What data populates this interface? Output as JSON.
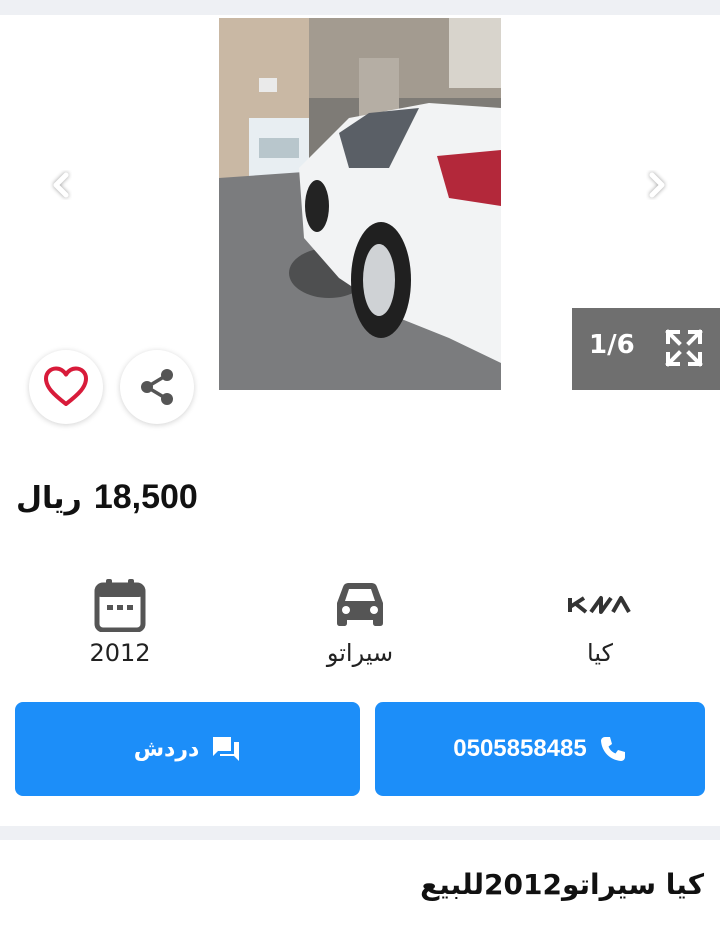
{
  "gallery": {
    "counter": "1/6",
    "photo_alt": "white-sedan-photo"
  },
  "icons": {
    "prev": "chevron-left-icon",
    "next": "chevron-right-icon",
    "expand": "expand-icon",
    "favorite": "heart-icon",
    "share": "share-icon",
    "year": "calendar-icon",
    "model": "car-icon",
    "make": "kia-logo"
  },
  "price": {
    "value": "18,500",
    "currency": "ريال"
  },
  "specs": {
    "year": "2012",
    "model": "سيراتو",
    "make": "كيا",
    "make_logo_text": "KIA"
  },
  "actions": {
    "chat_label": "دردش",
    "call_label": "0505858485"
  },
  "listing": {
    "title": "كيا سيراتو2012للبيع"
  },
  "colors": {
    "accent": "#1c8ef9",
    "heart": "#d81b3a",
    "counter_bg": "#6f6f6f",
    "band": "#eef0f4"
  }
}
